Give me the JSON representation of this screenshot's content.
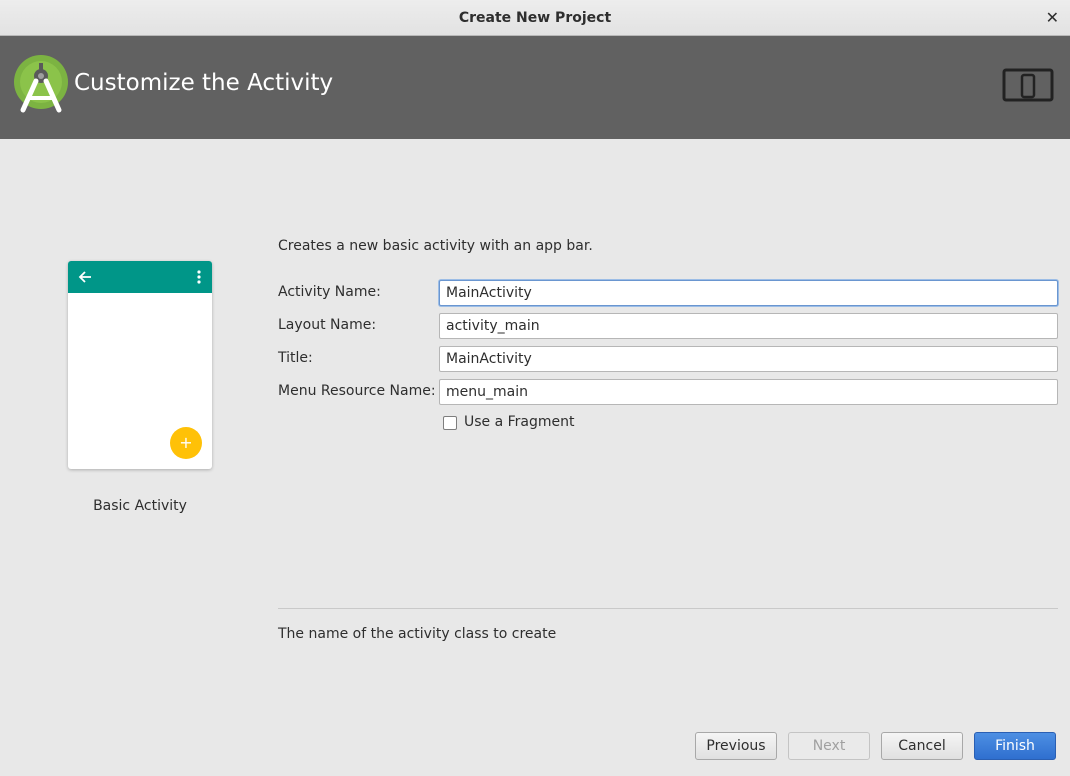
{
  "window": {
    "title": "Create New Project",
    "close_glyph": "✕"
  },
  "header": {
    "heading": "Customize the Activity",
    "logo_icon": "android-studio-logo-icon",
    "device_icon": "phone-tablet-icon"
  },
  "preview": {
    "caption": "Basic Activity",
    "fab_glyph": "+",
    "appbar_color": "#009688",
    "fab_color": "#FFC107"
  },
  "form": {
    "description": "Creates a new basic activity with an app bar.",
    "fields": [
      {
        "label": "Activity Name:",
        "value": "MainActivity"
      },
      {
        "label": "Layout Name:",
        "value": "activity_main"
      },
      {
        "label": "Title:",
        "value": "MainActivity"
      },
      {
        "label": "Menu Resource Name:",
        "value": "menu_main"
      }
    ],
    "use_fragment": {
      "label": "Use a Fragment",
      "checked": false
    }
  },
  "help_text": "The name of the activity class to create",
  "buttons": {
    "previous": "Previous",
    "next": "Next",
    "cancel": "Cancel",
    "finish": "Finish"
  },
  "colors": {
    "accent": "#3D7FD9",
    "banner": "#616161"
  }
}
